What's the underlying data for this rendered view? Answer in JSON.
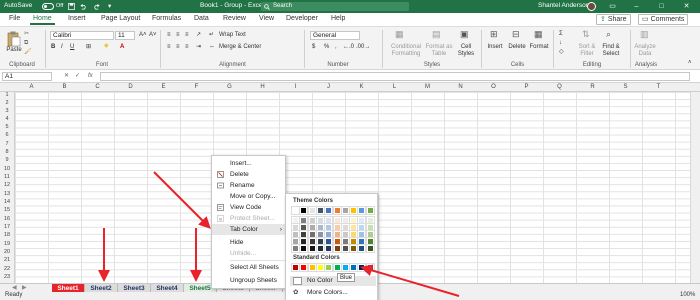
{
  "titlebar": {
    "autosave": "AutoSave",
    "toggle_state": "Off",
    "doc_title": "Book1 - Group - Excel",
    "search_placeholder": "Search",
    "user_name": "Shantel Anderson",
    "bg_color": "#217346"
  },
  "ribbon_tabs": [
    "File",
    "Home",
    "Insert",
    "Page Layout",
    "Formulas",
    "Data",
    "Review",
    "View",
    "Developer",
    "Help"
  ],
  "share_label": "Share",
  "comments_label": "Comments",
  "clipboard": {
    "paste": "Paste",
    "group": "Clipboard"
  },
  "font": {
    "name": "Calibri",
    "size": "11",
    "bold": "B",
    "italic": "I",
    "underline": "U",
    "group": "Font"
  },
  "alignment": {
    "wrap": "Wrap Text",
    "merge": "Merge & Center",
    "group": "Alignment"
  },
  "number": {
    "format": "General",
    "pct": "%",
    "comma": ",",
    "group": "Number"
  },
  "styles": {
    "cond": "Conditional Formatting",
    "table": "Format as Table",
    "cell": "Cell Styles",
    "group": "Styles"
  },
  "cells": {
    "insert": "Insert",
    "delete": "Delete",
    "format": "Format",
    "group": "Cells"
  },
  "editing": {
    "sort": "Sort & Filter",
    "find": "Find & Select",
    "group": "Editing"
  },
  "analysis": {
    "analyze": "Analyze Data",
    "group": "Analysis"
  },
  "namebox": "A1",
  "fx": "fx",
  "columns": [
    "A",
    "B",
    "C",
    "D",
    "E",
    "F",
    "G",
    "H",
    "I",
    "J",
    "K",
    "L",
    "M",
    "N",
    "O",
    "P",
    "Q",
    "R",
    "S",
    "T"
  ],
  "rows": [
    "1",
    "2",
    "3",
    "4",
    "5",
    "6",
    "7",
    "8",
    "9",
    "10",
    "11",
    "12",
    "13",
    "14",
    "15",
    "16",
    "17",
    "18",
    "19",
    "20",
    "21",
    "22",
    "23"
  ],
  "sheet_tabs": [
    {
      "label": "Sheet1",
      "bg": "#e8232a",
      "fg": "#ffffff"
    },
    {
      "label": "Sheet2",
      "bg": "#dcdcdc",
      "fg": "#1f3864"
    },
    {
      "label": "Sheet3",
      "bg": "#dcdcdc",
      "fg": "#1f3864"
    },
    {
      "label": "Sheet4",
      "bg": "#dcdcdc",
      "fg": "#1f3864"
    },
    {
      "label": "Sheet5",
      "bg": "#e2eee2",
      "fg": "#217346"
    },
    {
      "label": "Sheet6",
      "bg": "#f0f0f0",
      "fg": "#888888"
    },
    {
      "label": "Sheet7",
      "bg": "#f0f0f0",
      "fg": "#888888"
    }
  ],
  "status": {
    "ready": "Ready",
    "zoom": "100%"
  },
  "context_menu": {
    "insert": "Insert...",
    "delete": "Delete",
    "rename": "Rename",
    "move_copy": "Move or Copy...",
    "view_code": "View Code",
    "protect": "Protect Sheet...",
    "tab_color": "Tab Color",
    "hide": "Hide",
    "unhide": "Unhide...",
    "select_all": "Select All Sheets",
    "ungroup": "Ungroup Sheets"
  },
  "palette": {
    "theme_title": "Theme Colors",
    "standard_title": "Standard Colors",
    "no_color": "No Color",
    "more_colors": "More Colors...",
    "tooltip": "Blue",
    "theme_colors": [
      [
        "#ffffff",
        "#000000",
        "#e7e6e6",
        "#44546a",
        "#4472c4",
        "#ed7d31",
        "#a5a5a5",
        "#ffc000",
        "#5b9bd5",
        "#70ad47"
      ],
      [
        "#f2f2f2",
        "#7f7f7f",
        "#d0cece",
        "#d6dce4",
        "#d9e2f3",
        "#fbe5d5",
        "#ededed",
        "#fff2cc",
        "#deebf6",
        "#e2efd9"
      ],
      [
        "#d8d8d8",
        "#595959",
        "#aeabab",
        "#adb9ca",
        "#b4c6e7",
        "#f7cbac",
        "#dbdbdb",
        "#fee599",
        "#bdd7ee",
        "#c5e0b3"
      ],
      [
        "#bfbfbf",
        "#3f3f3f",
        "#757070",
        "#8496b0",
        "#8eaadb",
        "#f4b183",
        "#c9c9c9",
        "#ffd965",
        "#9cc3e5",
        "#a8d08d"
      ],
      [
        "#a5a5a5",
        "#262626",
        "#3a3838",
        "#323f4f",
        "#2f5496",
        "#c55a11",
        "#7b7b7b",
        "#bf8f00",
        "#2e75b5",
        "#538135"
      ],
      [
        "#7f7f7f",
        "#0c0c0c",
        "#171616",
        "#222a35",
        "#1f3864",
        "#833c0b",
        "#525252",
        "#7f6000",
        "#1f4e79",
        "#375623"
      ]
    ],
    "standard_colors": [
      "#c00000",
      "#ff0000",
      "#ffc000",
      "#ffff00",
      "#92d050",
      "#00b050",
      "#00b0f0",
      "#0070c0",
      "#002060",
      "#7030a0"
    ]
  }
}
